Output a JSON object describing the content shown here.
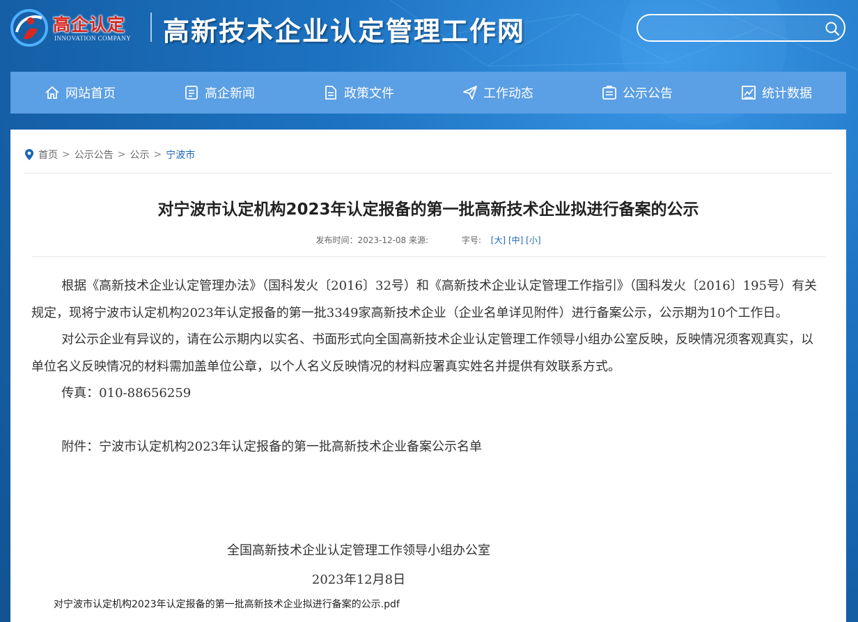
{
  "header": {
    "logo_text": "高企认定",
    "logo_sub": "INNOVATION COMPANY",
    "site_title": "高新技术企业认定管理工作网",
    "search_placeholder": ""
  },
  "nav": {
    "items": [
      {
        "label": "网站首页",
        "icon": "home-icon"
      },
      {
        "label": "高企新闻",
        "icon": "news-icon"
      },
      {
        "label": "政策文件",
        "icon": "document-icon"
      },
      {
        "label": "工作动态",
        "icon": "send-icon"
      },
      {
        "label": "公示公告",
        "icon": "notice-icon"
      },
      {
        "label": "统计数据",
        "icon": "chart-icon"
      }
    ]
  },
  "breadcrumb": {
    "items": [
      "首页",
      "公示公告",
      "公示",
      "宁波市"
    ],
    "separator": ">"
  },
  "article": {
    "title": "对宁波市认定机构2023年认定报备的第一批高新技术企业拟进行备案的公示",
    "meta_publish": "发布时间：2023-12-08 来源:",
    "meta_size_label": "字号:",
    "size_large": "[大]",
    "size_medium": "[中]",
    "size_small": "[小]",
    "paragraphs": [
      "根据《高新技术企业认定管理办法》（国科发火〔2016〕32号）和《高新技术企业认定管理工作指引》（国科发火〔2016〕195号）有关规定，现将宁波市认定机构2023年认定报备的第一批3349家高新技术企业（企业名单详见附件）进行备案公示，公示期为10个工作日。",
      "对公示企业有异议的，请在公示期内以实名、书面形式向全国高新技术企业认定管理工作领导小组办公室反映，反映情况须客观真实，以单位名义反映情况的材料需加盖单位公章，以个人名义反映情况的材料应署真实姓名并提供有效联系方式。",
      "传真：010-88656259",
      "附件：宁波市认定机构2023年认定报备的第一批高新技术企业备案公示名单"
    ],
    "signature": "全国高新技术企业认定管理工作领导小组办公室",
    "date": "2023年12月8日",
    "attachment_link": "对宁波市认定机构2023年认定报备的第一批高新技术企业拟进行备案的公示.pdf"
  },
  "colors": {
    "nav_bg": "#5b9fe4",
    "header_bg": "#1b6fb8",
    "link": "#1a66b8",
    "logo_red": "#d8281f"
  }
}
